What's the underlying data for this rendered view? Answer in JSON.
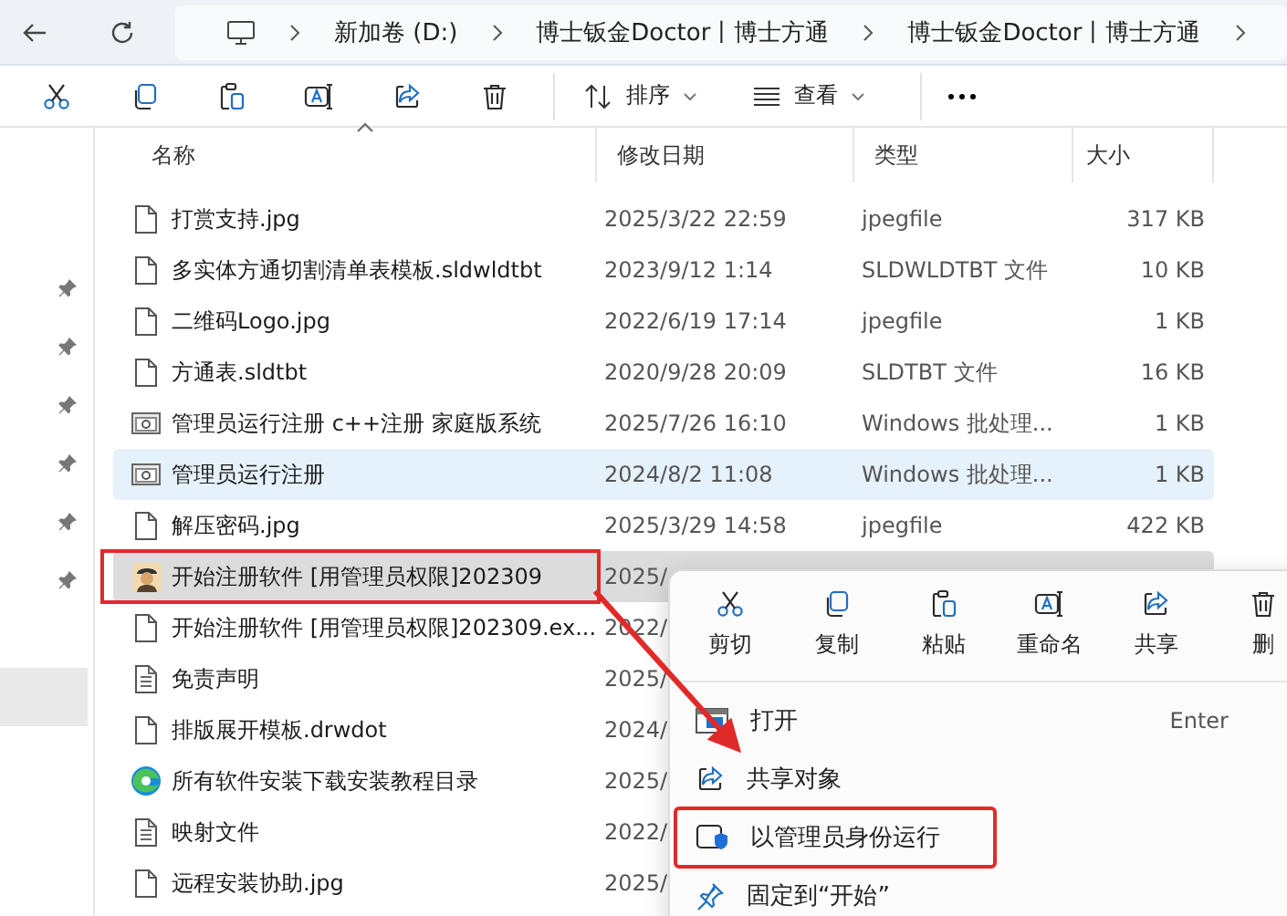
{
  "address_bar": {
    "crumbs": [
      "新加卷 (D:)",
      "博士钣金Doctor丨博士方通",
      "博士钣金Doctor丨博士方通"
    ]
  },
  "toolbar": {
    "sort": "排序",
    "view": "查看"
  },
  "sidebar": {
    "items": [
      {
        "pinned": true,
        "selected": false
      },
      {
        "pinned": true,
        "selected": false
      },
      {
        "pinned": true,
        "selected": false
      },
      {
        "pinned": true,
        "selected": false
      },
      {
        "pinned": true,
        "selected": false
      },
      {
        "pinned": true,
        "selected": false
      },
      {
        "pinned": false,
        "selected": true
      }
    ]
  },
  "columns": [
    "名称",
    "修改日期",
    "类型",
    "大小"
  ],
  "rows": [
    {
      "kind": "file",
      "name": "打赏支持.jpg",
      "date": "2025/3/22 22:59",
      "type": "jpegfile",
      "size": "317 KB",
      "selected": false,
      "hovered": false,
      "annotated": false
    },
    {
      "kind": "file",
      "name": "多实体方通切割清单表模板.sldwldtbt",
      "date": "2023/9/12 1:14",
      "type": "SLDWLDTBT 文件",
      "size": "10 KB",
      "selected": false,
      "hovered": false,
      "annotated": false
    },
    {
      "kind": "file",
      "name": "二维码Logo.jpg",
      "date": "2022/6/19 17:14",
      "type": "jpegfile",
      "size": "1 KB",
      "selected": false,
      "hovered": false,
      "annotated": false
    },
    {
      "kind": "file",
      "name": "方通表.sldtbt",
      "date": "2020/9/28 20:09",
      "type": "SLDTBT 文件",
      "size": "16 KB",
      "selected": false,
      "hovered": false,
      "annotated": false
    },
    {
      "kind": "batch",
      "name": "管理员运行注册 c++注册  家庭版系统",
      "date": "2025/7/26 16:10",
      "type": "Windows 批处理...",
      "size": "1 KB",
      "selected": false,
      "hovered": false,
      "annotated": false
    },
    {
      "kind": "batch",
      "name": "管理员运行注册",
      "date": "2024/8/2 11:08",
      "type": "Windows 批处理...",
      "size": "1 KB",
      "selected": false,
      "hovered": true,
      "annotated": false
    },
    {
      "kind": "file",
      "name": "解压密码.jpg",
      "date": "2025/3/29 14:58",
      "type": "jpegfile",
      "size": "422 KB",
      "selected": false,
      "hovered": false,
      "annotated": false
    },
    {
      "kind": "app",
      "name": "开始注册软件 [用管理员权限]202309",
      "date": "2025/",
      "selected": true,
      "hovered": false,
      "annotated": true
    },
    {
      "kind": "file",
      "name": "开始注册软件 [用管理员权限]202309.ex...",
      "date": "2022/",
      "selected": false,
      "hovered": false,
      "annotated": false
    },
    {
      "kind": "text",
      "name": "免责声明",
      "date": "2025/",
      "selected": false,
      "hovered": false,
      "annotated": false
    },
    {
      "kind": "file",
      "name": "排版展开模板.drwdot",
      "date": "2024/",
      "selected": false,
      "hovered": false,
      "annotated": false
    },
    {
      "kind": "web",
      "name": "所有软件安装下载安装教程目录",
      "date": "2025/",
      "selected": false,
      "hovered": false,
      "annotated": false
    },
    {
      "kind": "text",
      "name": "映射文件",
      "date": "2022/",
      "selected": false,
      "hovered": false,
      "annotated": false
    },
    {
      "kind": "file",
      "name": "远程安装协助.jpg",
      "date": "2025/",
      "selected": false,
      "hovered": false,
      "annotated": false
    }
  ],
  "context_menu": {
    "actions": [
      {
        "kind": "cut",
        "label": "剪切"
      },
      {
        "kind": "copy",
        "label": "复制"
      },
      {
        "kind": "paste",
        "label": "粘贴"
      },
      {
        "kind": "rename",
        "label": "重命名"
      },
      {
        "kind": "share",
        "label": "共享"
      },
      {
        "kind": "delete",
        "label": "删"
      }
    ],
    "items": [
      {
        "kind": "open",
        "label": "打开",
        "shortcut": "Enter",
        "annotated": false
      },
      {
        "kind": "share",
        "label": "共享对象",
        "annotated": false
      },
      {
        "kind": "admin",
        "label": "以管理员身份运行",
        "annotated": true
      },
      {
        "kind": "pin",
        "label": "固定到“开始”",
        "annotated": false
      }
    ]
  }
}
